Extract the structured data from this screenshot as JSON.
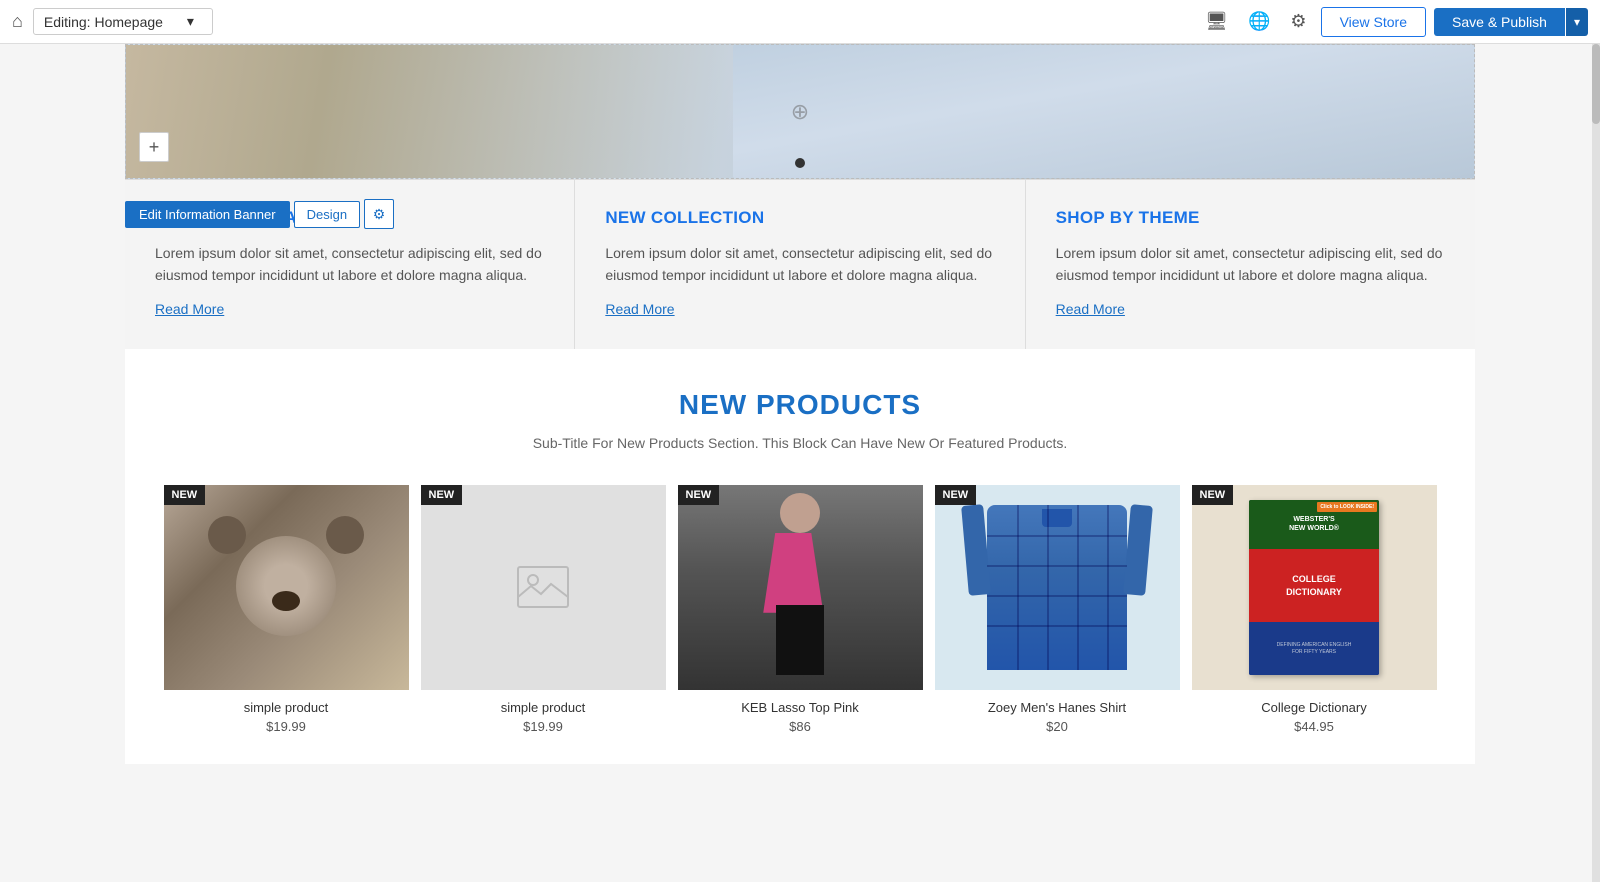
{
  "topNav": {
    "homeIcon": "⌂",
    "editingLabel": "Editing: Homepage",
    "dropdownArrow": "▾",
    "icons": {
      "monitor": "🖥",
      "globe": "🌐",
      "settings": "⚙"
    },
    "viewStoreLabel": "View Store",
    "savePublishLabel": "Save & Publish",
    "savePublishArrow": "▾"
  },
  "editToolbar": {
    "editBannerLabel": "Edit Information Banner",
    "designLabel": "Design",
    "settingsIcon": "⚙"
  },
  "addSection": {
    "icon": "+"
  },
  "infoCards": [
    {
      "title": "EXCLUSIVE BRANDS",
      "body": "Lorem ipsum dolor sit amet, consectetur adipiscing elit, sed do eiusmod tempor incididunt ut labore et dolore magna aliqua.",
      "readMore": "Read More"
    },
    {
      "title": "NEW COLLECTION",
      "body": "Lorem ipsum dolor sit amet, consectetur adipiscing elit, sed do eiusmod tempor incididunt ut labore et dolore magna aliqua.",
      "readMore": "Read More"
    },
    {
      "title": "SHOP BY THEME",
      "body": "Lorem ipsum dolor sit amet, consectetur adipiscing elit, sed do eiusmod tempor incididunt ut labore et dolore magna aliqua.",
      "readMore": "Read More"
    }
  ],
  "newProducts": {
    "title": "NEW PRODUCTS",
    "subtitle": "Sub-Title For New Products Section. This Block Can Have New Or Featured Products.",
    "badgeLabel": "NEW",
    "products": [
      {
        "name": "simple product",
        "price": "$19.99",
        "imageType": "koala"
      },
      {
        "name": "simple product",
        "price": "$19.99",
        "imageType": "placeholder"
      },
      {
        "name": "KEB Lasso Top Pink",
        "price": "$86",
        "imageType": "pink"
      },
      {
        "name": "Zoey Men's Hanes Shirt",
        "price": "$20",
        "imageType": "blue-shirt"
      },
      {
        "name": "College Dictionary",
        "price": "$44.95",
        "imageType": "book"
      }
    ]
  }
}
